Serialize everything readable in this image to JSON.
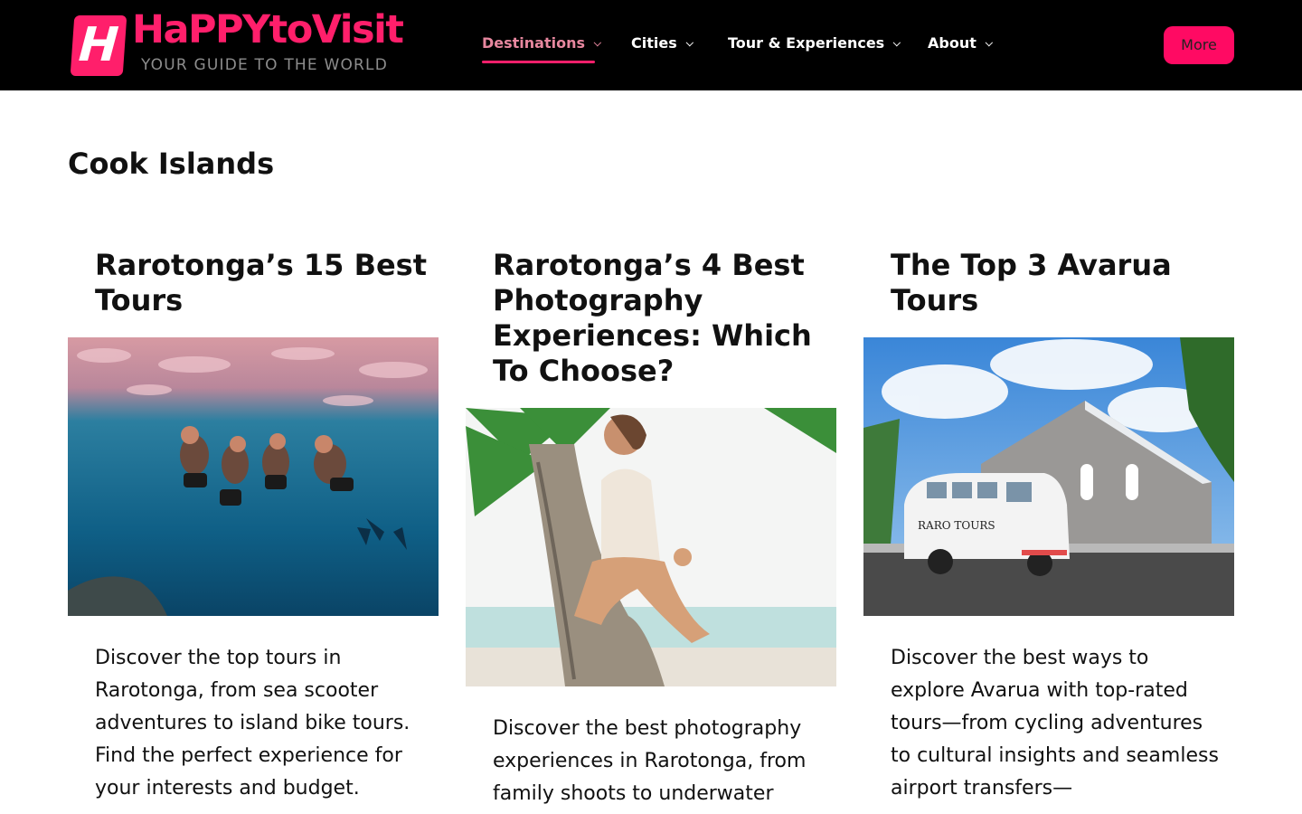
{
  "brand": {
    "badge_letter": "H",
    "name": "HaPPYtoVisit",
    "tagline": "YOUR GUIDE TO THE WORLD",
    "accent_color": "#ff1f6b"
  },
  "nav": {
    "items": [
      {
        "label": "Destinations",
        "active": true
      },
      {
        "label": "Cities",
        "active": false
      },
      {
        "label": "Tour & Experiences",
        "active": false
      },
      {
        "label": "About",
        "active": false
      }
    ],
    "more_label": "More"
  },
  "page": {
    "title": "Cook Islands"
  },
  "cards": [
    {
      "title": "Rarotonga’s 15 Best Tours",
      "image": "underwater-snorkel-scene",
      "excerpt": "Discover the top tours in Rarotonga, from sea scooter adventures to island bike tours. Find the perfect experience for your interests and budget."
    },
    {
      "title": "Rarotonga’s 4 Best Photography Experiences: Which To Choose?",
      "image": "woman-on-palm-tree-scene",
      "excerpt": "Discover the best photography experiences in Rarotonga, from family shoots to underwater"
    },
    {
      "title": "The Top 3 Avarua Tours",
      "image": "tour-bus-church-scene",
      "bus_label": "RARO TOURS",
      "excerpt": "Discover the best ways to explore Avarua with top-rated tours—from cycling adventures to cultural insights and seamless airport transfers—"
    }
  ]
}
